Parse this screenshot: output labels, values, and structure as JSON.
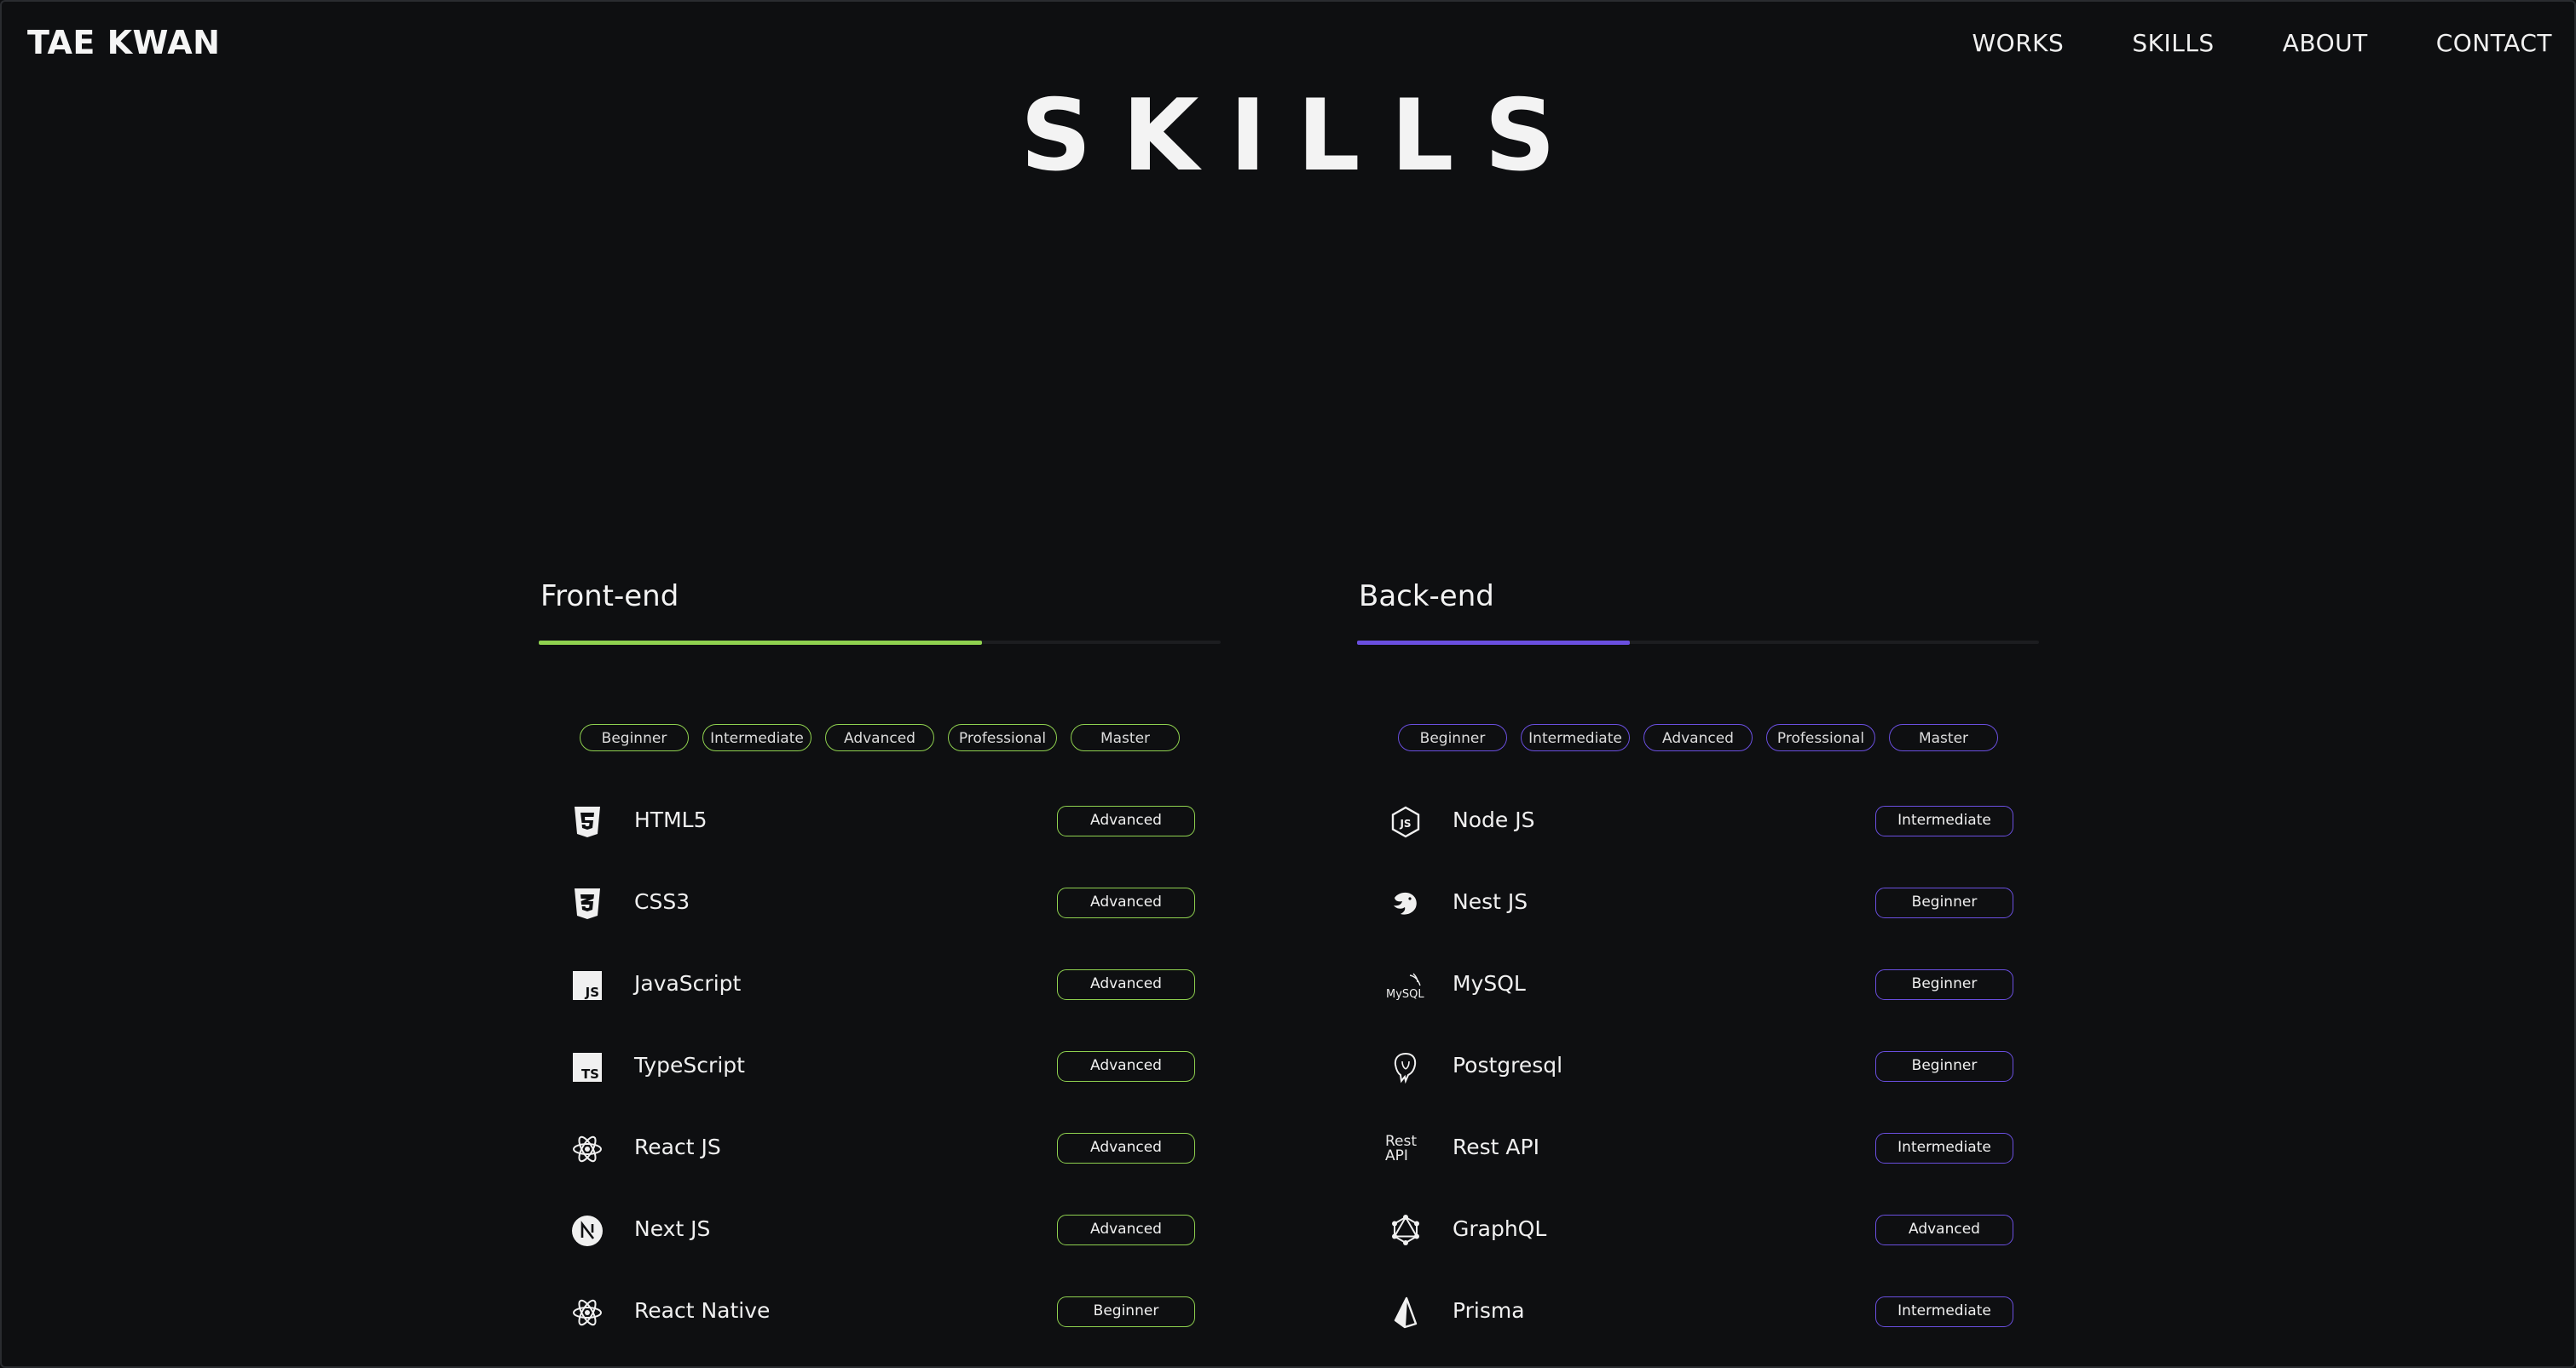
{
  "header": {
    "logo": "TAE KWAN",
    "nav": [
      "WORKS",
      "SKILLS",
      "ABOUT",
      "CONTACT"
    ]
  },
  "page_title": "SKILLS",
  "levels": [
    "Beginner",
    "Intermediate",
    "Advanced",
    "Professional",
    "Master"
  ],
  "frontend": {
    "title": "Front-end",
    "accent": "#8fd14f",
    "progress": 0.65,
    "skills": [
      {
        "name": "HTML5",
        "level": "Advanced",
        "icon": "html5-icon"
      },
      {
        "name": "CSS3",
        "level": "Advanced",
        "icon": "css3-icon"
      },
      {
        "name": "JavaScript",
        "level": "Advanced",
        "icon": "javascript-icon"
      },
      {
        "name": "TypeScript",
        "level": "Advanced",
        "icon": "typescript-icon"
      },
      {
        "name": "React JS",
        "level": "Advanced",
        "icon": "react-icon"
      },
      {
        "name": "Next JS",
        "level": "Advanced",
        "icon": "nextjs-icon"
      },
      {
        "name": "React Native",
        "level": "Beginner",
        "icon": "react-icon"
      }
    ]
  },
  "backend": {
    "title": "Back-end",
    "accent": "#6a4fe0",
    "progress": 0.4,
    "skills": [
      {
        "name": "Node JS",
        "level": "Intermediate",
        "icon": "nodejs-icon"
      },
      {
        "name": "Nest JS",
        "level": "Beginner",
        "icon": "nestjs-icon"
      },
      {
        "name": "MySQL",
        "level": "Beginner",
        "icon": "mysql-icon",
        "icon_text": "MySQL"
      },
      {
        "name": "Postgresql",
        "level": "Beginner",
        "icon": "postgresql-icon"
      },
      {
        "name": "Rest API",
        "level": "Intermediate",
        "icon": "rest-api-icon",
        "icon_text": "Rest API"
      },
      {
        "name": "GraphQL",
        "level": "Advanced",
        "icon": "graphql-icon"
      },
      {
        "name": "Prisma",
        "level": "Intermediate",
        "icon": "prisma-icon"
      }
    ]
  }
}
